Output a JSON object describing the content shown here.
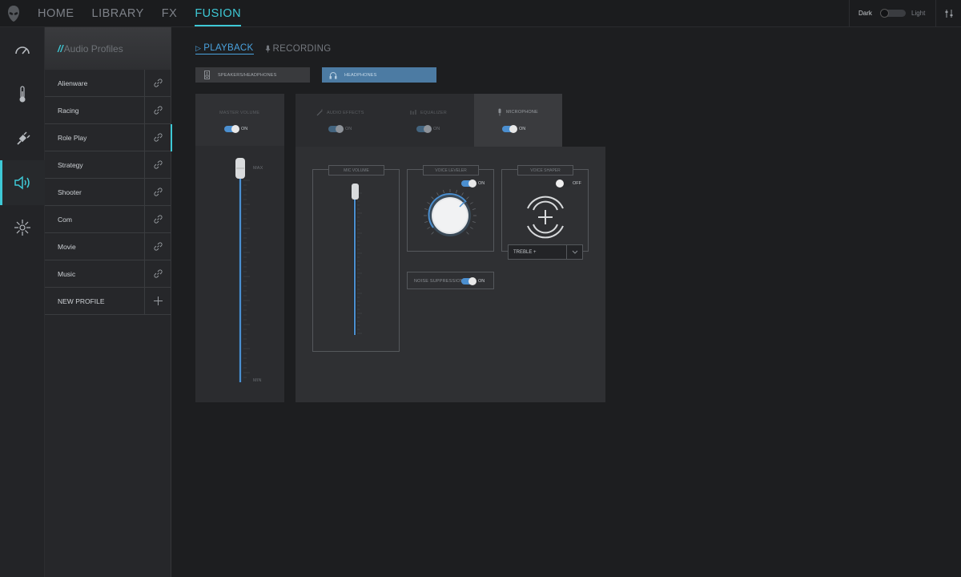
{
  "app": {
    "nav": [
      "HOME",
      "LIBRARY",
      "FX",
      "FUSION"
    ],
    "active_nav": "FUSION",
    "theme": {
      "dark_label": "Dark",
      "light_label": "Light"
    },
    "accent_color": "#3ec9d6",
    "blue_color": "#4b8fd0"
  },
  "rail": {
    "icons": [
      "gauge-icon",
      "thermometer-icon",
      "power-plug-icon",
      "speaker-icon",
      "sun-icon"
    ],
    "active": "speaker-icon"
  },
  "profiles": {
    "header_prefix": "//",
    "header_title": "Audio Profiles",
    "items": [
      {
        "label": "Alienware"
      },
      {
        "label": "Racing"
      },
      {
        "label": "Role Play"
      },
      {
        "label": "Strategy"
      },
      {
        "label": "Shooter"
      },
      {
        "label": "Com"
      },
      {
        "label": "Movie"
      },
      {
        "label": "Music"
      },
      {
        "label": "NEW PROFILE"
      }
    ],
    "active_profile": "Role Play"
  },
  "main": {
    "tabs": [
      {
        "label": "PLAYBACK",
        "icon": "play-icon"
      },
      {
        "label": "RECORDING",
        "icon": "mic-icon"
      }
    ],
    "devices": [
      {
        "label": "SPEAKERS/HEADPHONES",
        "icon": "speaker-device-icon"
      },
      {
        "label": "HEADPHONES",
        "icon": "headphones-icon"
      }
    ],
    "master": {
      "label": "MASTER VOLUME",
      "toggle_label": "ON",
      "max_label": "MAX",
      "min_label": "MIN",
      "level": 1.0
    },
    "effect_tabs": [
      {
        "label": "AUDIO EFFECTS",
        "toggle": "ON"
      },
      {
        "label": "EQUALIZER",
        "toggle": "ON"
      },
      {
        "label": "MICROPHONE",
        "toggle": "ON"
      }
    ],
    "mic_volume": {
      "label": "MIC VOLUME",
      "level": 1.0
    },
    "voice_leveler": {
      "label": "VOICE LEVELER",
      "toggle": "ON"
    },
    "voice_shaper": {
      "label": "VOICE SHAPER",
      "toggle": "OFF"
    },
    "noise_suppression": {
      "label": "NOISE SUPPRESSION",
      "toggle": "ON"
    },
    "shaper_select": {
      "value": "TREBLE +"
    }
  }
}
